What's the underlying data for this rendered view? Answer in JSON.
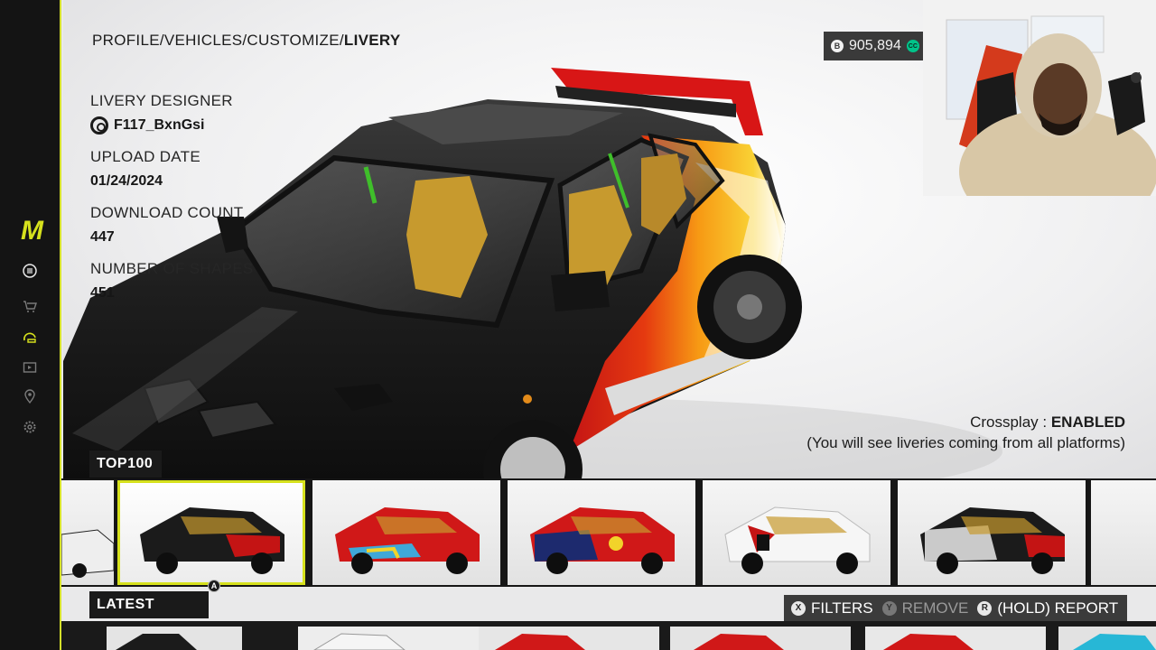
{
  "breadcrumb": {
    "path": "PROFILE/VEHICLES/CUSTOMIZE/",
    "current": "LIVERY"
  },
  "info": {
    "designer_label": "LIVERY DESIGNER",
    "designer_value": "F117_BxnGsi",
    "upload_label": "UPLOAD DATE",
    "upload_value": "01/24/2024",
    "download_label": "DOWNLOAD COUNT",
    "download_value": "447",
    "shapes_label": "NUMBER OF SHAPES",
    "shapes_value": "451"
  },
  "currency": {
    "amount": "905,894",
    "coin_glyph": "B",
    "cc_glyph": "CC"
  },
  "crossplay": {
    "label": "Crossplay : ",
    "status": "ENABLED",
    "note": "(You will see liveries coming from all platforms)"
  },
  "rows": {
    "top100_label": "TOP100",
    "latest_label": "LATEST"
  },
  "actions": {
    "filters_glyph": "X",
    "filters": "FILTERS",
    "remove_glyph": "Y",
    "remove": "REMOVE",
    "report_glyph": "R",
    "report": "(HOLD) REPORT",
    "select_glyph": "A"
  },
  "sidebar": {
    "logo": "M",
    "icons": [
      "menu-icon",
      "cart-icon",
      "garage-icon",
      "video-icon",
      "map-pin-icon",
      "settings-icon"
    ]
  },
  "colors": {
    "accent": "#d6e11d",
    "sidebar_bg": "#141414",
    "crossplay_icon": "#00c48a"
  }
}
